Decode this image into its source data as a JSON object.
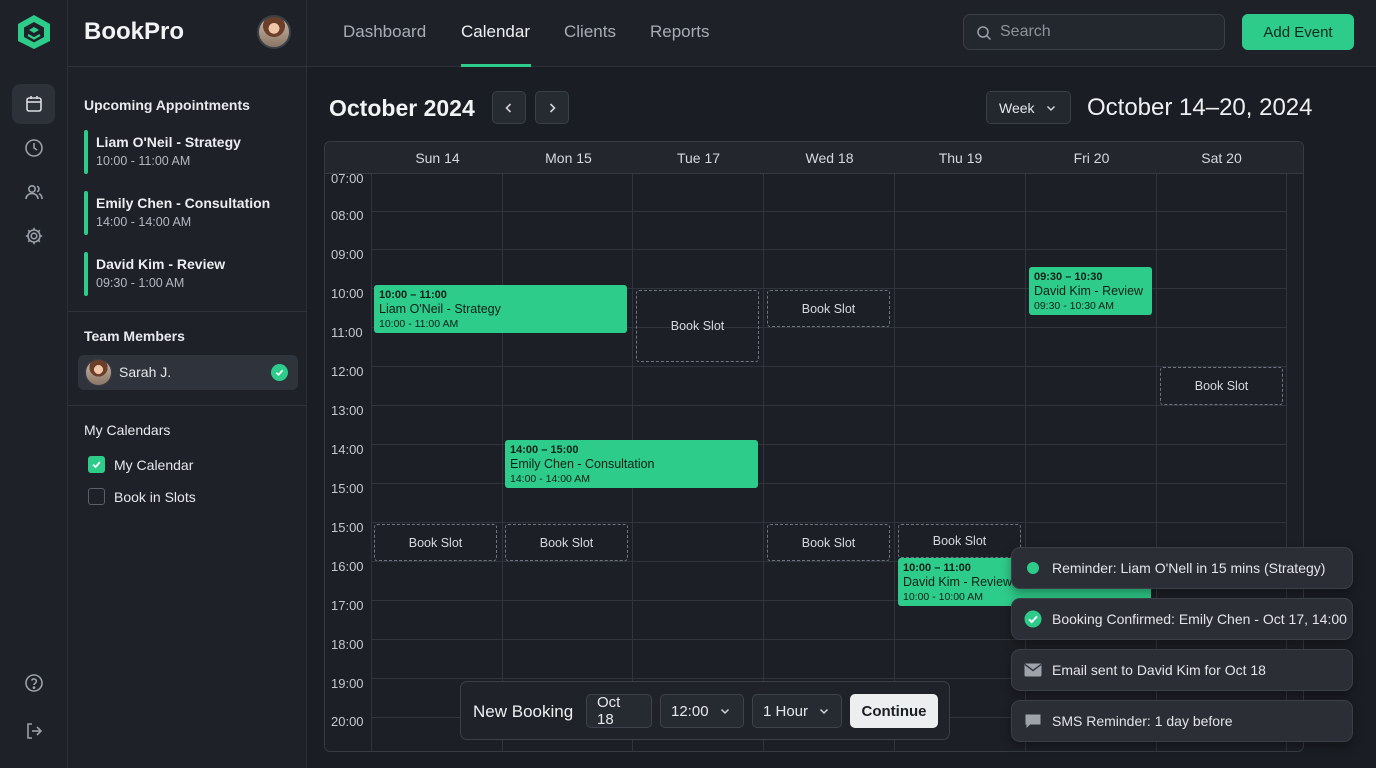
{
  "app": {
    "name": "BookPro"
  },
  "nav": {
    "tabs": [
      {
        "label": "Dashboard"
      },
      {
        "label": "Calendar"
      },
      {
        "label": "Clients"
      },
      {
        "label": "Reports"
      }
    ],
    "active_tab": "Calendar"
  },
  "search": {
    "placeholder": "Search",
    "value": ""
  },
  "add_event_label": "Add Event",
  "sidebar": {
    "upcoming_title": "Upcoming Appointments",
    "appointments": [
      {
        "title": "Liam O'Neil - Strategy",
        "time": "10:00 - 11:00 AM"
      },
      {
        "title": "Emily Chen - Consultation",
        "time": "14:00 - 14:00 AM"
      },
      {
        "title": "David Kim - Review",
        "time": "09:30 - 1:00 AM"
      }
    ],
    "team_title": "Team Members",
    "team": [
      {
        "name": "Sarah J.",
        "selected": true
      }
    ],
    "calendars_title": "My Calendars",
    "calendars": [
      {
        "label": "My Calendar",
        "checked": true
      },
      {
        "label": "Book in Slots",
        "checked": false
      }
    ]
  },
  "calendar": {
    "month_title": "October 2024",
    "view": "Week",
    "range_title": "October 14–20, 2024",
    "days": [
      "Sun 14",
      "Mon 15",
      "Tue 17",
      "Wed 18",
      "Thu 19",
      "Fri 20",
      "Sat 20"
    ],
    "times": [
      "07:00",
      "08:00",
      "09:00",
      "10:00",
      "11:00",
      "12:00",
      "13:00",
      "14:00",
      "15:00",
      "15:00",
      "16:00",
      "17:00",
      "18:00",
      "19:00",
      "20:00"
    ],
    "events": [
      {
        "range": "10:00 – 11:00",
        "title": "Liam O'Neil - Strategy",
        "sub": "10:00 - 11:00 AM"
      },
      {
        "range": "14:00 – 15:00",
        "title": "Emily Chen - Consultation",
        "sub": "14:00 - 14:00 AM"
      },
      {
        "range": "09:30 – 10:30",
        "title": "David Kim - Review",
        "sub": "09:30 - 10:30 AM"
      },
      {
        "range": "10:00 – 11:00",
        "title": "David Kim - Review",
        "sub": "10:00 - 10:00 AM"
      }
    ],
    "slot_label": "Book Slot"
  },
  "booking": {
    "label": "New Booking",
    "date": "Oct 18",
    "time": "12:00",
    "duration": "1 Hour",
    "continue_label": "Continue"
  },
  "notifications": [
    {
      "text": "Reminder: Liam O'Nell in 15 mins (Strategy)",
      "icon": "dot-icon"
    },
    {
      "text": "Booking Confirmed: Emily Chen - Oct 17, 14:00",
      "icon": "check-circle-icon"
    },
    {
      "text": "Email sent to David Kim for Oct 18",
      "icon": "mail-icon"
    },
    {
      "text": "SMS Reminder: 1 day before",
      "icon": "chat-icon"
    }
  ],
  "colors": {
    "accent": "#2ecc8a",
    "background": "#1a1d23",
    "panel": "#1e2128"
  }
}
